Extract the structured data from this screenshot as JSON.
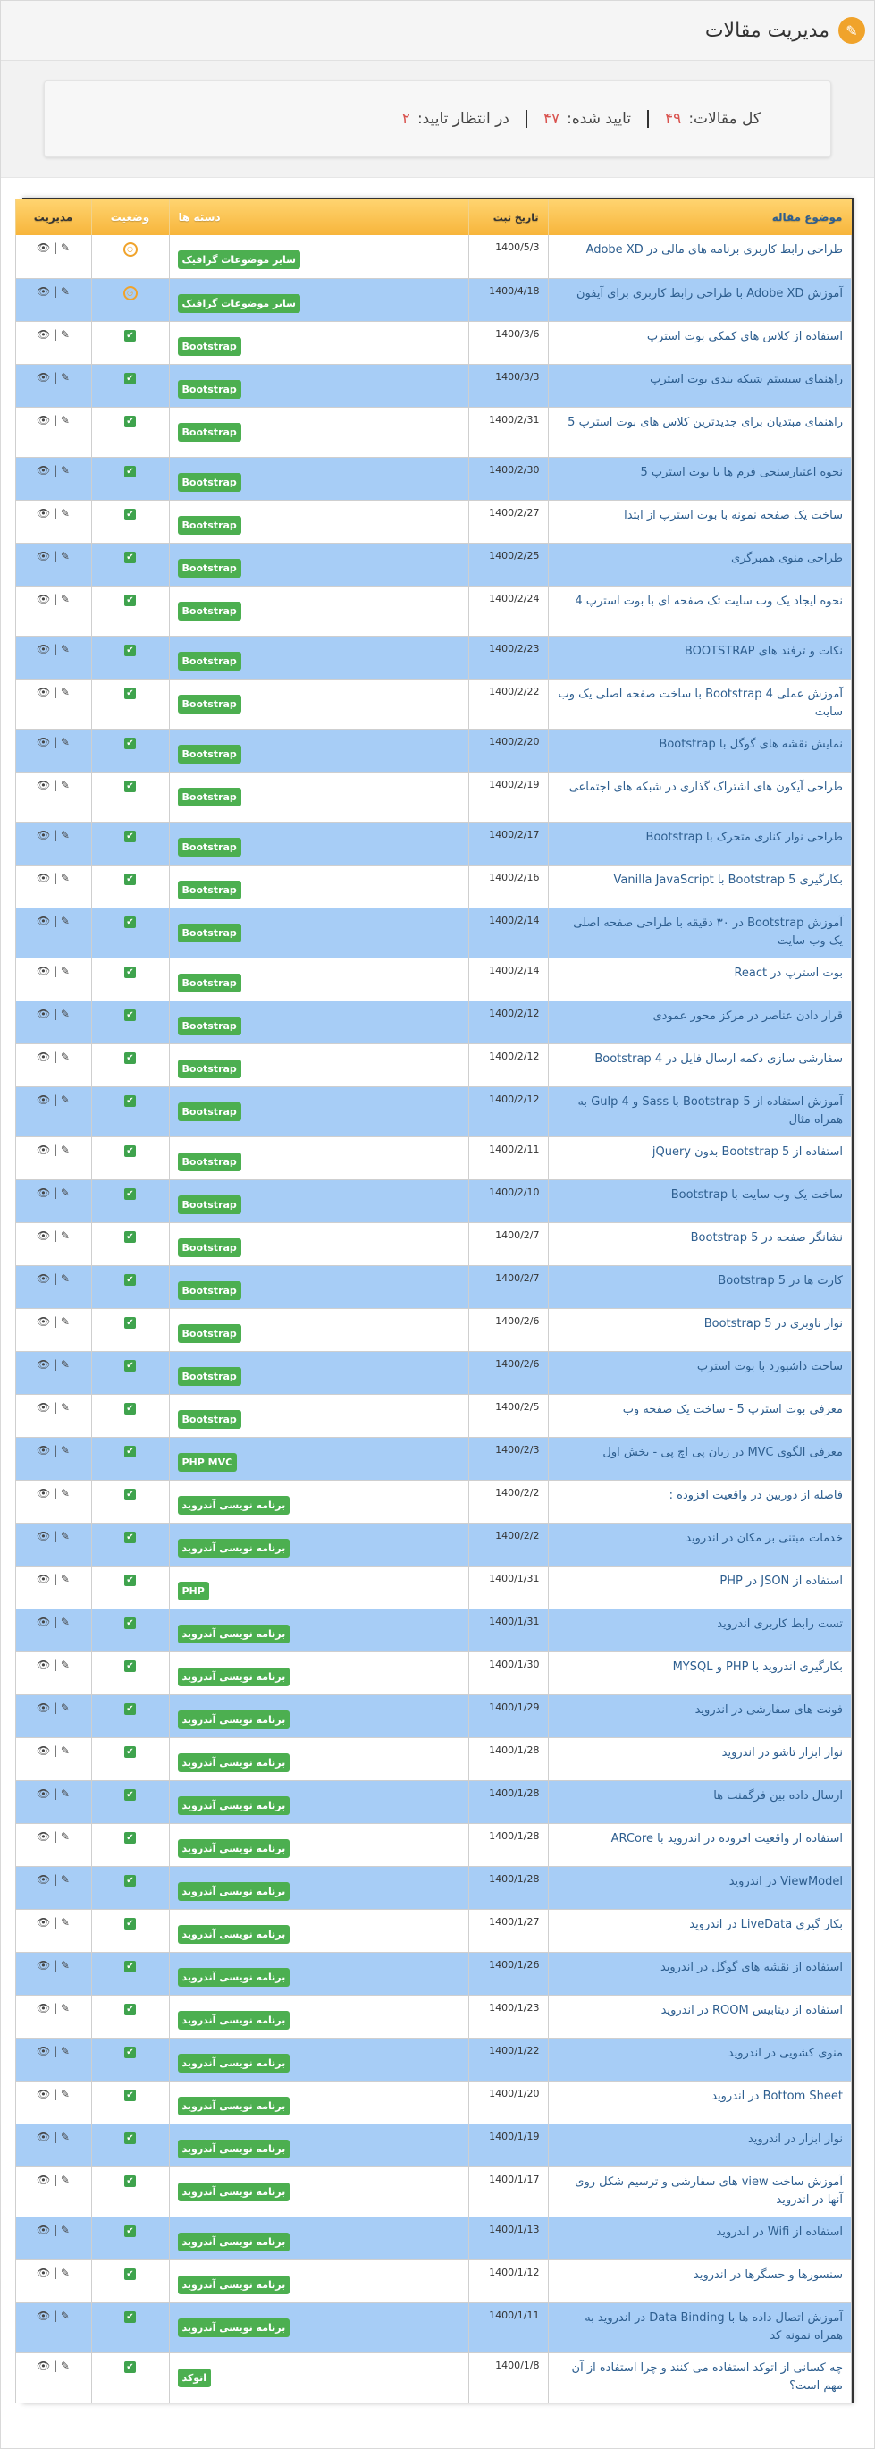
{
  "header": {
    "title": "مدیریت مقالات",
    "logo_icon": "pencil-icon"
  },
  "stats": {
    "total_label": "کل مقالات:",
    "total_value": "۴۹",
    "approved_label": "تایید شده:",
    "approved_value": "۴۷",
    "pending_label": "در انتظار تایید:",
    "pending_value": "۲"
  },
  "table": {
    "headers": {
      "title": "موضوع مقاله",
      "date": "تاریخ ثبت",
      "category": "دسته ها",
      "status": "وضعیت",
      "manage": "مدیریت"
    },
    "manage_icons": [
      "view-icon",
      "edit-icon"
    ],
    "rows": [
      {
        "title": "طراحی رابط کاربری برنامه های مالی در Adobe XD",
        "date": "1400/5/3",
        "category": "سایر موضوعات گرافیک",
        "status": "pending",
        "tall": false
      },
      {
        "title": "آموزش Adobe XD با طراحی رابط کاربری برای آیفون",
        "date": "1400/4/18",
        "category": "سایر موضوعات گرافیک",
        "status": "pending",
        "tall": false
      },
      {
        "title": "استفاده از کلاس های کمکی بوت استرپ",
        "date": "1400/3/6",
        "category": "Bootstrap",
        "status": "approved",
        "tall": false
      },
      {
        "title": "راهنمای سیستم شبکه بندی بوت استرپ",
        "date": "1400/3/3",
        "category": "Bootstrap",
        "status": "approved",
        "tall": false
      },
      {
        "title": "راهنمای مبتدیان برای جدیدترین کلاس های بوت استرپ 5",
        "date": "1400/2/31",
        "category": "Bootstrap",
        "status": "approved",
        "tall": true
      },
      {
        "title": "نحوه اعتبارسنجی فرم ها با بوت استرپ 5",
        "date": "1400/2/30",
        "category": "Bootstrap",
        "status": "approved",
        "tall": false
      },
      {
        "title": "ساخت یک صفحه نمونه با بوت استرپ از ابتدا",
        "date": "1400/2/27",
        "category": "Bootstrap",
        "status": "approved",
        "tall": false
      },
      {
        "title": "طراحی منوی همبرگری",
        "date": "1400/2/25",
        "category": "Bootstrap",
        "status": "approved",
        "tall": false
      },
      {
        "title": "نحوه ایجاد یک وب سایت تک صفحه ای با بوت استرپ 4",
        "date": "1400/2/24",
        "category": "Bootstrap",
        "status": "approved",
        "tall": true
      },
      {
        "title": "نکات و ترفند های BOOTSTRAP",
        "date": "1400/2/23",
        "category": "Bootstrap",
        "status": "approved",
        "tall": false
      },
      {
        "title": "آموزش عملی Bootstrap 4 با ساخت صفحه اصلی یک وب سایت",
        "date": "1400/2/22",
        "category": "Bootstrap",
        "status": "approved",
        "tall": true
      },
      {
        "title": "نمایش نقشه های گوگل با Bootstrap",
        "date": "1400/2/20",
        "category": "Bootstrap",
        "status": "approved",
        "tall": false
      },
      {
        "title": "طراحی آیکون های اشتراک گذاری در شبکه های اجتماعی",
        "date": "1400/2/19",
        "category": "Bootstrap",
        "status": "approved",
        "tall": true
      },
      {
        "title": "طراحی نوار کناری متحرک با Bootstrap",
        "date": "1400/2/17",
        "category": "Bootstrap",
        "status": "approved",
        "tall": false
      },
      {
        "title": "بکارگیری Bootstrap 5 با Vanilla JavaScript",
        "date": "1400/2/16",
        "category": "Bootstrap",
        "status": "approved",
        "tall": false
      },
      {
        "title": "آموزش Bootstrap در ۳۰ دقیقه با طراحی صفحه اصلی یک وب سایت",
        "date": "1400/2/14",
        "category": "Bootstrap",
        "status": "approved",
        "tall": true
      },
      {
        "title": "بوت استرپ در React",
        "date": "1400/2/14",
        "category": "Bootstrap",
        "status": "approved",
        "tall": false
      },
      {
        "title": "قرار دادن عناصر در مرکز محور عمودی",
        "date": "1400/2/12",
        "category": "Bootstrap",
        "status": "approved",
        "tall": false
      },
      {
        "title": "سفارشی سازی دکمه ارسال فایل در Bootstrap 4",
        "date": "1400/2/12",
        "category": "Bootstrap",
        "status": "approved",
        "tall": false
      },
      {
        "title": "آموزش استفاده از Bootstrap 5 با Sass و Gulp 4 به همراه مثال",
        "date": "1400/2/12",
        "category": "Bootstrap",
        "status": "approved",
        "tall": true
      },
      {
        "title": "استفاده از Bootstrap 5 بدون jQuery",
        "date": "1400/2/11",
        "category": "Bootstrap",
        "status": "approved",
        "tall": false
      },
      {
        "title": "ساخت یک وب سایت با Bootstrap",
        "date": "1400/2/10",
        "category": "Bootstrap",
        "status": "approved",
        "tall": false
      },
      {
        "title": "نشانگر صفحه در Bootstrap 5",
        "date": "1400/2/7",
        "category": "Bootstrap",
        "status": "approved",
        "tall": false
      },
      {
        "title": "کارت ها در Bootstrap 5",
        "date": "1400/2/7",
        "category": "Bootstrap",
        "status": "approved",
        "tall": false
      },
      {
        "title": "نوار ناوبری در Bootstrap 5",
        "date": "1400/2/6",
        "category": "Bootstrap",
        "status": "approved",
        "tall": false
      },
      {
        "title": "ساخت داشبورد با بوت استرپ",
        "date": "1400/2/6",
        "category": "Bootstrap",
        "status": "approved",
        "tall": false
      },
      {
        "title": "معرفی بوت استرپ 5 - ساخت یک صفحه وب",
        "date": "1400/2/5",
        "category": "Bootstrap",
        "status": "approved",
        "tall": false
      },
      {
        "title": "معرفی الگوی MVC در زبان پی اچ پی - بخش اول",
        "date": "1400/2/3",
        "category": "PHP MVC",
        "status": "approved",
        "tall": false
      },
      {
        "title": "فاصله از دوربین در واقعیت افزوده :",
        "date": "1400/2/2",
        "category": "برنامه نویسی آندروید",
        "status": "approved",
        "tall": false
      },
      {
        "title": "خدمات مبتنی بر مکان در اندروید",
        "date": "1400/2/2",
        "category": "برنامه نویسی آندروید",
        "status": "approved",
        "tall": false
      },
      {
        "title": "استفاده از JSON در PHP",
        "date": "1400/1/31",
        "category": "PHP",
        "status": "approved",
        "tall": false
      },
      {
        "title": "تست رابط کاربری اندروید",
        "date": "1400/1/31",
        "category": "برنامه نویسی آندروید",
        "status": "approved",
        "tall": false
      },
      {
        "title": "بکارگیری اندروید با PHP و MYSQL",
        "date": "1400/1/30",
        "category": "برنامه نویسی آندروید",
        "status": "approved",
        "tall": false
      },
      {
        "title": "فونت های سفارشی در اندروید",
        "date": "1400/1/29",
        "category": "برنامه نویسی آندروید",
        "status": "approved",
        "tall": false
      },
      {
        "title": "نوار ابزار تاشو در اندروید",
        "date": "1400/1/28",
        "category": "برنامه نویسی آندروید",
        "status": "approved",
        "tall": false
      },
      {
        "title": "ارسال داده بین فرگمنت ها",
        "date": "1400/1/28",
        "category": "برنامه نویسی آندروید",
        "status": "approved",
        "tall": false
      },
      {
        "title": "استفاده از واقعیت افزوده در اندروید با ARCore",
        "date": "1400/1/28",
        "category": "برنامه نویسی آندروید",
        "status": "approved",
        "tall": false
      },
      {
        "title": "ViewModel در اندروید",
        "date": "1400/1/28",
        "category": "برنامه نویسی آندروید",
        "status": "approved",
        "tall": false
      },
      {
        "title": "بکار گیری LiveData در اندروید",
        "date": "1400/1/27",
        "category": "برنامه نویسی آندروید",
        "status": "approved",
        "tall": false
      },
      {
        "title": "استفاده از نقشه های گوگل در اندروید",
        "date": "1400/1/26",
        "category": "برنامه نویسی آندروید",
        "status": "approved",
        "tall": false
      },
      {
        "title": "استفاده از دیتابیس ROOM در اندروید",
        "date": "1400/1/23",
        "category": "برنامه نویسی آندروید",
        "status": "approved",
        "tall": false
      },
      {
        "title": "منوی کشویی در اندروید",
        "date": "1400/1/22",
        "category": "برنامه نویسی آندروید",
        "status": "approved",
        "tall": false
      },
      {
        "title": "Bottom Sheet در اندروید",
        "date": "1400/1/20",
        "category": "برنامه نویسی آندروید",
        "status": "approved",
        "tall": false
      },
      {
        "title": "نوار ابزار در اندروید",
        "date": "1400/1/19",
        "category": "برنامه نویسی آندروید",
        "status": "approved",
        "tall": false
      },
      {
        "title": "آموزش ساخت view های سفارشی و ترسیم شکل روی آنها در اندروید",
        "date": "1400/1/17",
        "category": "برنامه نویسی آندروید",
        "status": "approved",
        "tall": true
      },
      {
        "title": "استفاده از Wifi در اندروید",
        "date": "1400/1/13",
        "category": "برنامه نویسی آندروید",
        "status": "approved",
        "tall": false
      },
      {
        "title": "سنسورها و حسگرها در اندروید",
        "date": "1400/1/12",
        "category": "برنامه نویسی آندروید",
        "status": "approved",
        "tall": false
      },
      {
        "title": "آموزش اتصال داده ها با Data Binding در اندروید به همراه نمونه کد",
        "date": "1400/1/11",
        "category": "برنامه نویسی آندروید",
        "status": "approved",
        "tall": true
      },
      {
        "title": "چه کسانی از اتوکد استفاده می کنند و چرا استفاده از آن مهم است؟",
        "date": "1400/1/8",
        "category": "اتوکد",
        "status": "approved",
        "tall": true
      }
    ]
  }
}
